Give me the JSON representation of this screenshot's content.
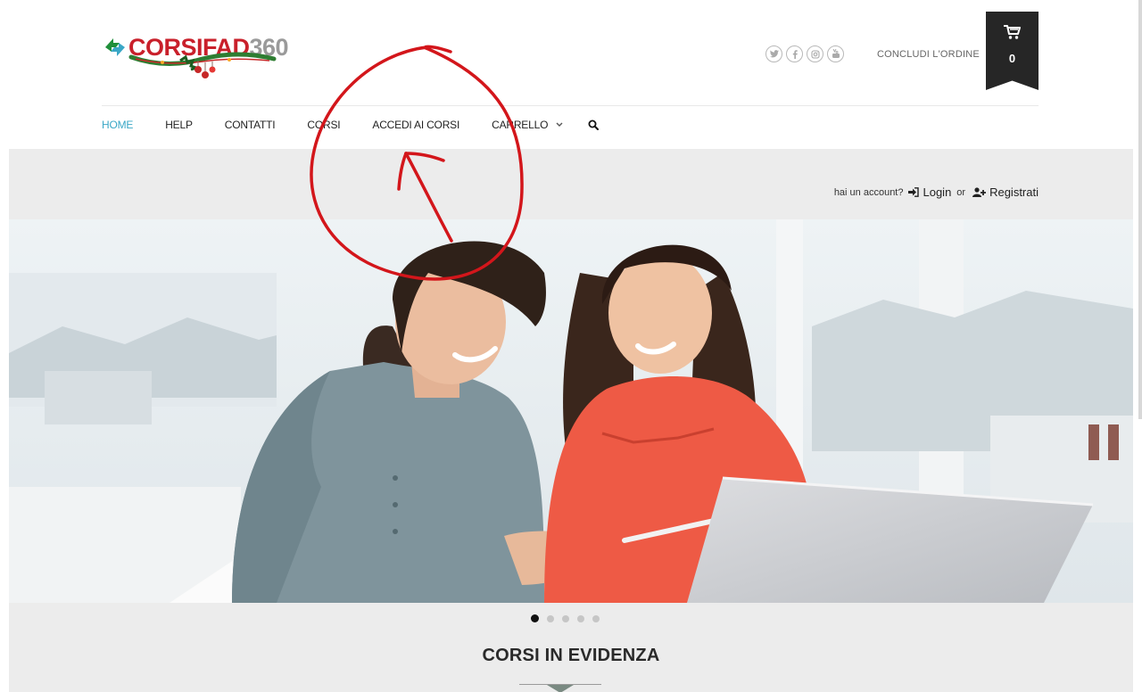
{
  "brand": {
    "logo_red": "CORSIFAD",
    "logo_grey": "360"
  },
  "header": {
    "social_icons": [
      "twitter-icon",
      "facebook-icon",
      "instagram-icon",
      "youtube-icon"
    ],
    "checkout_label": "CONCLUDI L'ORDINE",
    "cart_count": "0"
  },
  "nav": {
    "items": [
      {
        "label": "HOME",
        "active": true
      },
      {
        "label": "HELP"
      },
      {
        "label": "CONTATTI"
      },
      {
        "label": "CORSI"
      },
      {
        "label": "ACCEDI AI CORSI"
      },
      {
        "label": "CARRELLO",
        "has_dropdown": true
      }
    ]
  },
  "account": {
    "prompt": "hai un account?",
    "login": "Login",
    "or": "or",
    "register": "Registrati"
  },
  "slider": {
    "total": 5,
    "active_index": 0
  },
  "featured": {
    "title": "CORSI IN EVIDENZA"
  },
  "colors": {
    "accent": "#3aa7c6",
    "brand_red": "#c9202b",
    "annotation_red": "#d3161b"
  }
}
